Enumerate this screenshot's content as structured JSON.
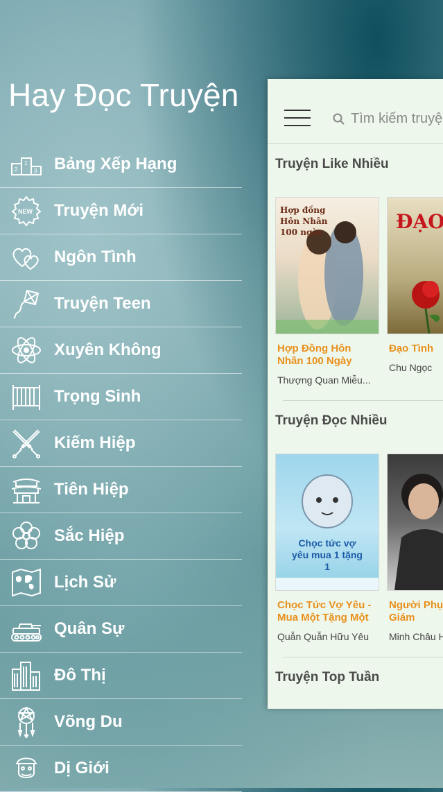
{
  "app": {
    "title": "Hay Đọc Truyện"
  },
  "menu": [
    {
      "label": "Bảng Xếp Hạng",
      "icon": "podium-icon"
    },
    {
      "label": "Truyện Mới",
      "icon": "new-badge-icon"
    },
    {
      "label": "Ngôn Tình",
      "icon": "hearts-icon"
    },
    {
      "label": "Truyện Teen",
      "icon": "kite-icon"
    },
    {
      "label": "Xuyên Không",
      "icon": "atom-icon"
    },
    {
      "label": "Trọng Sinh",
      "icon": "crib-icon"
    },
    {
      "label": "Kiếm Hiệp",
      "icon": "crossed-swords-icon"
    },
    {
      "label": "Tiên Hiệp",
      "icon": "pagoda-icon"
    },
    {
      "label": "Sắc Hiệp",
      "icon": "flower-icon"
    },
    {
      "label": "Lịch Sử",
      "icon": "world-map-icon"
    },
    {
      "label": "Quân Sự",
      "icon": "tank-icon"
    },
    {
      "label": "Đô Thị",
      "icon": "buildings-icon"
    },
    {
      "label": "Võng Du",
      "icon": "dreamcatcher-icon"
    },
    {
      "label": "Dị Giới",
      "icon": "warrior-head-icon"
    }
  ],
  "panel": {
    "search_placeholder": "Tìm kiếm truyện",
    "sections": [
      {
        "title": "Truyện Like Nhiều",
        "books": [
          {
            "title": "Hợp Đồng Hôn Nhân 100 Ngày",
            "author": "Thượng Quan Miễu...",
            "cover_text": "Hợp đồng Hôn Nhân 100 ngày"
          },
          {
            "title": "Đạo Tình",
            "author": "Chu Ngọc",
            "cover_text": "ĐẠO"
          }
        ]
      },
      {
        "title": "Truyện Đọc Nhiều",
        "books": [
          {
            "title": "Chọc Tức Vợ Yêu - Mua Một Tặng Một",
            "author": "Quẫn Quẫn Hữu Yêu",
            "cover_text": "Chọc tức vợ yêu mua 1 tặng 1"
          },
          {
            "title": "Người Phụ Tổng Giám",
            "author": "Minh Châu H",
            "cover_text": ""
          }
        ]
      },
      {
        "title": "Truyện Top Tuần",
        "books": []
      }
    ]
  },
  "colors": {
    "accent_title": "#e8901c",
    "panel_bg": "#eef7ec"
  }
}
